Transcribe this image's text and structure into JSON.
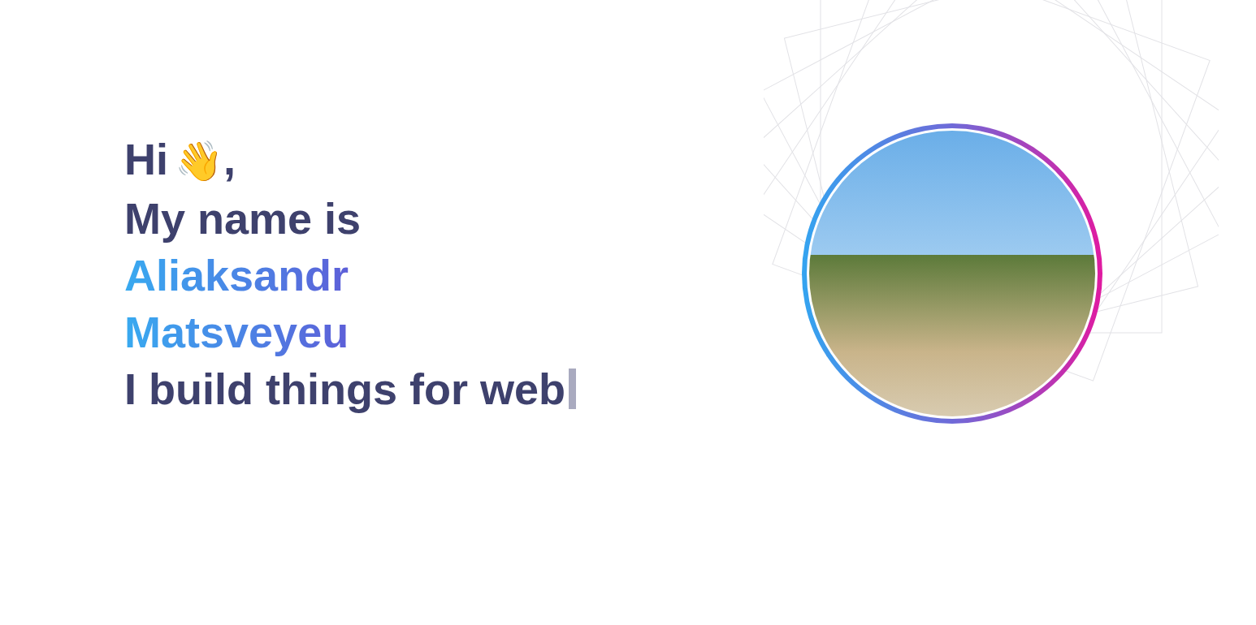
{
  "greeting": {
    "text": "Hi",
    "emoji": "👋",
    "punctuation": ","
  },
  "intro": "My name is",
  "name": [
    "Aliaksandr",
    "Matsveyeu"
  ],
  "tagline": "I build things for web",
  "cursor": {
    "visible": true
  }
}
